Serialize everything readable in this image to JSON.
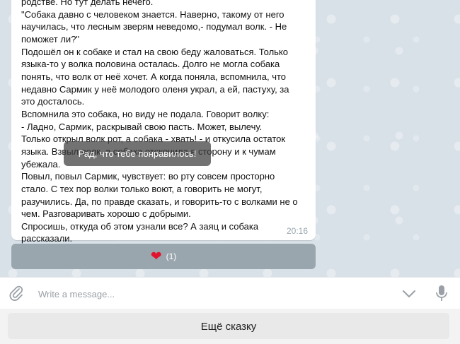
{
  "message": {
    "text_lines": [
      "родстве. Но тут делать нечего.",
      "\"Собака давно с человеком знается. Наверно, такому от него",
      "научилась, что лесным зверям неведомо,- подумал волк. - Не",
      "поможет ли?\"",
      "Подошёл он к собаке и стал на свою беду жаловаться. Только",
      "языка-то у волка половина осталась. Долго не могла собака",
      "понять, что волк от неё хочет. А когда поняла, вспомнила, что",
      "недавно Сармик у неё молодого оленя украл, а ей, пастуху, за",
      "это досталось.",
      "Вспомнила это собака, но виду не подала. Говорит волку:",
      "- Ладно, Сармик, раскрывай свою пасть. Может, вылечу.",
      "Только открыл волк рот, а собака - хвать! - и откусила остаток",
      "языка. Взвыл волк, а собака отскочила в сторону и к чумам убежала.",
      "Повыл, повыл Сармик, чувствует: во рту совсем просторно",
      "стало. С тех пор волки только воют, а говорить не могут,",
      "разучились. Да, по правде сказать, и говорить-то с волками не о",
      "чем. Разговаривать хорошо с добрыми.",
      "Спросишь, откуда об этом узнали все? А заяц и собака",
      "рассказали."
    ],
    "time": "20:16"
  },
  "toast": {
    "text": "Рад, что тебе понравилось!"
  },
  "reaction": {
    "emoji": "❤",
    "count": "(1)",
    "heart_color": "#e0142e"
  },
  "composer": {
    "placeholder": "Write a message..."
  },
  "keyboard": {
    "button_label": "Ещё сказку"
  },
  "icons": {
    "attach": "paperclip-icon",
    "chevron": "chevron-down-icon",
    "mic": "microphone-icon"
  }
}
